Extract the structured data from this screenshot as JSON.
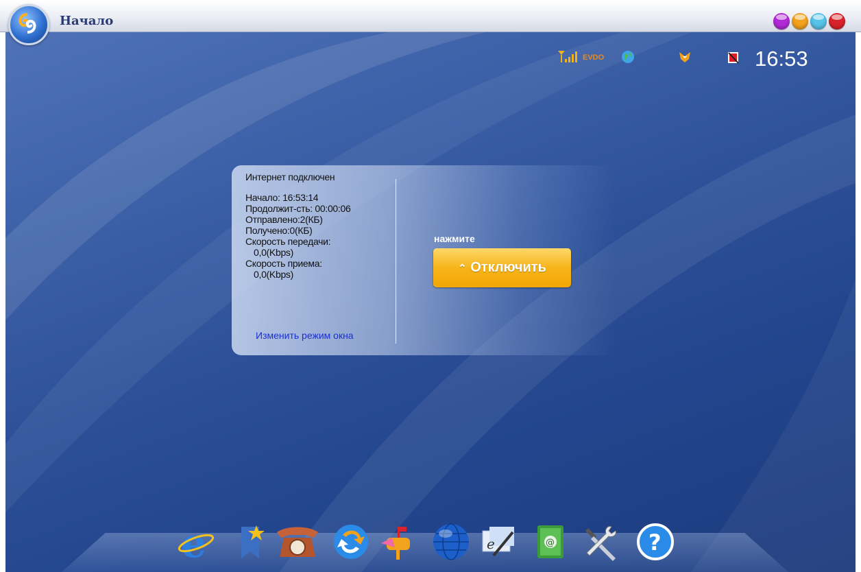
{
  "window": {
    "title": "Начало",
    "buttons": [
      {
        "name": "purple",
        "color": "#b12ad6"
      },
      {
        "name": "orange",
        "color": "#f2a21c"
      },
      {
        "name": "cyan",
        "color": "#57c3e8"
      },
      {
        "name": "red",
        "color": "#d9232c"
      }
    ]
  },
  "status_bar": {
    "network_type": "EVDO",
    "clock": "16:53"
  },
  "connection_panel": {
    "heading": "Интернет подключен",
    "start": "Начало: 16:53:14",
    "duration": "Продолжит-сть: 00:00:06",
    "sent": "Отправлено:2(КБ)",
    "received": "Получено:0(КБ)",
    "upload_label": "Скорость передачи:",
    "upload_value": "0,0(Kbps)",
    "download_label": "Скорость приема:",
    "download_value": "0,0(Kbps)",
    "change_mode_link": "Изменить режим окна",
    "prompt": "нажмите",
    "disconnect_label": "Отключить"
  },
  "dock": [
    "internet-explorer-icon",
    "favorites-icon",
    "telephone-icon",
    "sync-icon",
    "sms-mailbox-icon",
    "globe-icon",
    "notepad-icon",
    "address-book-icon",
    "tools-icon",
    "help-icon"
  ],
  "colors": {
    "desktop": "#2c4f97",
    "button": "#f6b41a",
    "link": "#1a2fd0"
  }
}
